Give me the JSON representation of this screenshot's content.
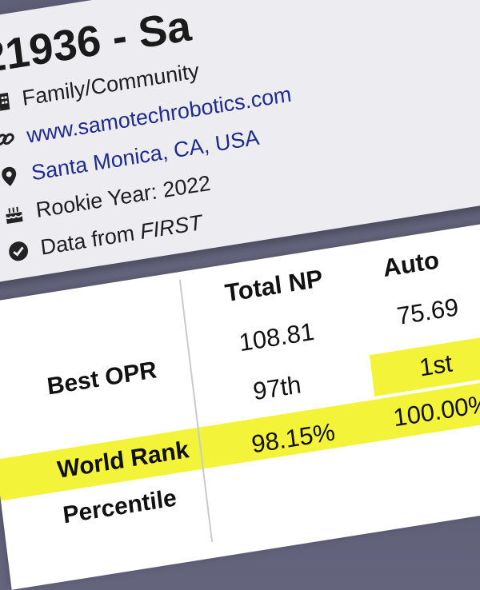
{
  "team": {
    "title": "21936 - Sa",
    "category": "Family/Community",
    "website": "www.samotechrobotics.com",
    "location": "Santa Monica, CA, USA",
    "rookie_year": "Rookie Year: 2022",
    "data_from_prefix": "Data from",
    "data_from_source": "FIRST"
  },
  "stats_table": {
    "headers": [
      "Total NP",
      "Auto"
    ],
    "rows": [
      {
        "label": "Best OPR",
        "values": [
          "108.81",
          "75.69"
        ]
      },
      {
        "label": "World Rank",
        "values": [
          "97th",
          "1st"
        ]
      },
      {
        "label": "Percentile",
        "values": [
          "98.15%",
          "100.00%"
        ]
      }
    ]
  },
  "colors": {
    "highlight": "#f3f33a",
    "link": "#1f2b8f",
    "card_bg": "#ececf1"
  },
  "icons": [
    "building-icon",
    "link-icon",
    "map-pin-icon",
    "cake-icon",
    "check-circle-icon"
  ]
}
